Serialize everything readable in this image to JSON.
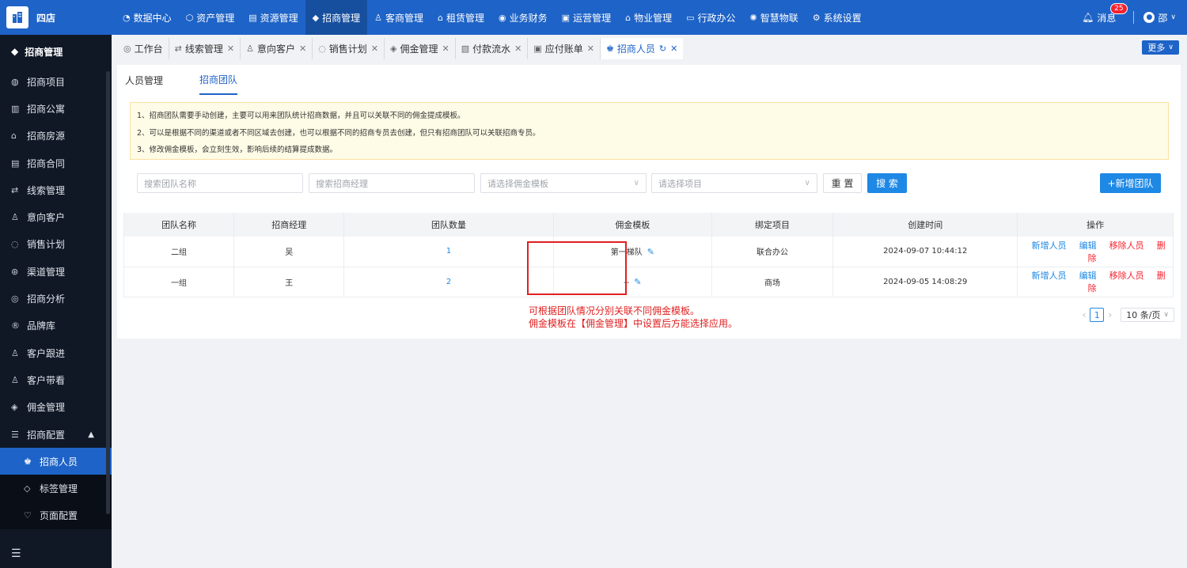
{
  "app": {
    "name": "四店",
    "logo_icon": "building-icon",
    "brand_color": "#1e63c7"
  },
  "topnav": [
    {
      "label": "数据中心",
      "icon": "dashboard-icon",
      "active": false
    },
    {
      "label": "资产管理",
      "icon": "cube-icon",
      "active": false
    },
    {
      "label": "资源管理",
      "icon": "building-icon",
      "active": false
    },
    {
      "label": "招商管理",
      "icon": "tag-icon",
      "active": true
    },
    {
      "label": "客商管理",
      "icon": "users-icon",
      "active": false
    },
    {
      "label": "租赁管理",
      "icon": "home-icon",
      "active": false
    },
    {
      "label": "业务财务",
      "icon": "coin-icon",
      "active": false
    },
    {
      "label": "运营管理",
      "icon": "chart-icon",
      "active": false
    },
    {
      "label": "物业管理",
      "icon": "house-icon",
      "active": false
    },
    {
      "label": "行政办公",
      "icon": "monitor-icon",
      "active": false
    },
    {
      "label": "智慧物联",
      "icon": "iot-icon",
      "active": false
    },
    {
      "label": "系统设置",
      "icon": "gear-icon",
      "active": false
    }
  ],
  "header_right": {
    "messages_label": "消息",
    "messages_count": "25",
    "user_name": "邵"
  },
  "sidebar": {
    "title": "招商管理",
    "items": [
      {
        "label": "招商项目",
        "icon": "project-icon"
      },
      {
        "label": "招商公寓",
        "icon": "apartment-icon"
      },
      {
        "label": "招商房源",
        "icon": "house-icon"
      },
      {
        "label": "招商合同",
        "icon": "contract-icon"
      },
      {
        "label": "线索管理",
        "icon": "clue-icon"
      },
      {
        "label": "意向客户",
        "icon": "user-icon"
      },
      {
        "label": "销售计划",
        "icon": "plan-icon"
      },
      {
        "label": "渠道管理",
        "icon": "channel-icon"
      },
      {
        "label": "招商分析",
        "icon": "analysis-icon"
      },
      {
        "label": "品牌库",
        "icon": "brand-icon"
      },
      {
        "label": "客户跟进",
        "icon": "follow-icon"
      },
      {
        "label": "客户带看",
        "icon": "visit-icon"
      },
      {
        "label": "佣金管理",
        "icon": "commission-icon"
      }
    ],
    "group": {
      "label": "招商配置",
      "icon": "config-icon",
      "children": [
        {
          "label": "招商人员",
          "icon": "staff-icon",
          "active": true
        },
        {
          "label": "标签管理",
          "icon": "tag-icon",
          "active": false
        },
        {
          "label": "页面配置",
          "icon": "page-icon",
          "active": false
        }
      ]
    }
  },
  "tabs": [
    {
      "label": "工作台",
      "icon": "workbench-icon",
      "closable": false
    },
    {
      "label": "线索管理",
      "icon": "clue-icon",
      "closable": true
    },
    {
      "label": "意向客户",
      "icon": "user-icon",
      "closable": true
    },
    {
      "label": "销售计划",
      "icon": "plan-icon",
      "closable": true
    },
    {
      "label": "佣金管理",
      "icon": "commission-icon",
      "closable": true
    },
    {
      "label": "付款流水",
      "icon": "payment-icon",
      "closable": true
    },
    {
      "label": "应付账单",
      "icon": "bill-icon",
      "closable": true
    },
    {
      "label": "招商人员",
      "icon": "staff-icon",
      "closable": true,
      "active": true
    }
  ],
  "more_label": "更多",
  "subtabs": [
    {
      "label": "人员管理",
      "active": false
    },
    {
      "label": "招商团队",
      "active": true
    }
  ],
  "notice": [
    "1、招商团队需要手动创建，主要可以用来团队统计招商数据，并且可以关联不同的佣金提成模板。",
    "2、可以是根据不同的渠道或者不同区域去创建，也可以根据不同的招商专员去创建，但只有招商团队可以关联招商专员。",
    "3、修改佣金模板，会立刻生效，影响后续的结算提成数据。"
  ],
  "filters": {
    "team_name_placeholder": "搜索团队名称",
    "manager_placeholder": "搜索招商经理",
    "template_placeholder": "请选择佣金模板",
    "project_placeholder": "请选择项目",
    "reset_label": "重 置",
    "search_label": "搜 索",
    "add_label": "+新增团队"
  },
  "table": {
    "headers": [
      "团队名称",
      "招商经理",
      "团队数量",
      "佣金模板",
      "绑定项目",
      "创建时间",
      "操作"
    ],
    "rows": [
      {
        "name": "二组",
        "manager": "吴",
        "count": "1",
        "template": "第一梯队",
        "project": "联合办公",
        "created": "2024-09-07 10:44:12"
      },
      {
        "name": "一组",
        "manager": "王",
        "count": "2",
        "template": "--",
        "project": "商场",
        "created": "2024-09-05 14:08:29"
      }
    ],
    "actions": {
      "add": "新增人员",
      "edit": "编辑",
      "remove": "移除人员",
      "delete": "删除"
    }
  },
  "annotation": {
    "line1": "可根据团队情况分别关联不同佣金模板。",
    "line2": "佣金模板在【佣金管理】中设置后方能选择应用。",
    "color": "#e02020"
  },
  "pagination": {
    "current_page": "1",
    "page_size": "10 条/页"
  }
}
